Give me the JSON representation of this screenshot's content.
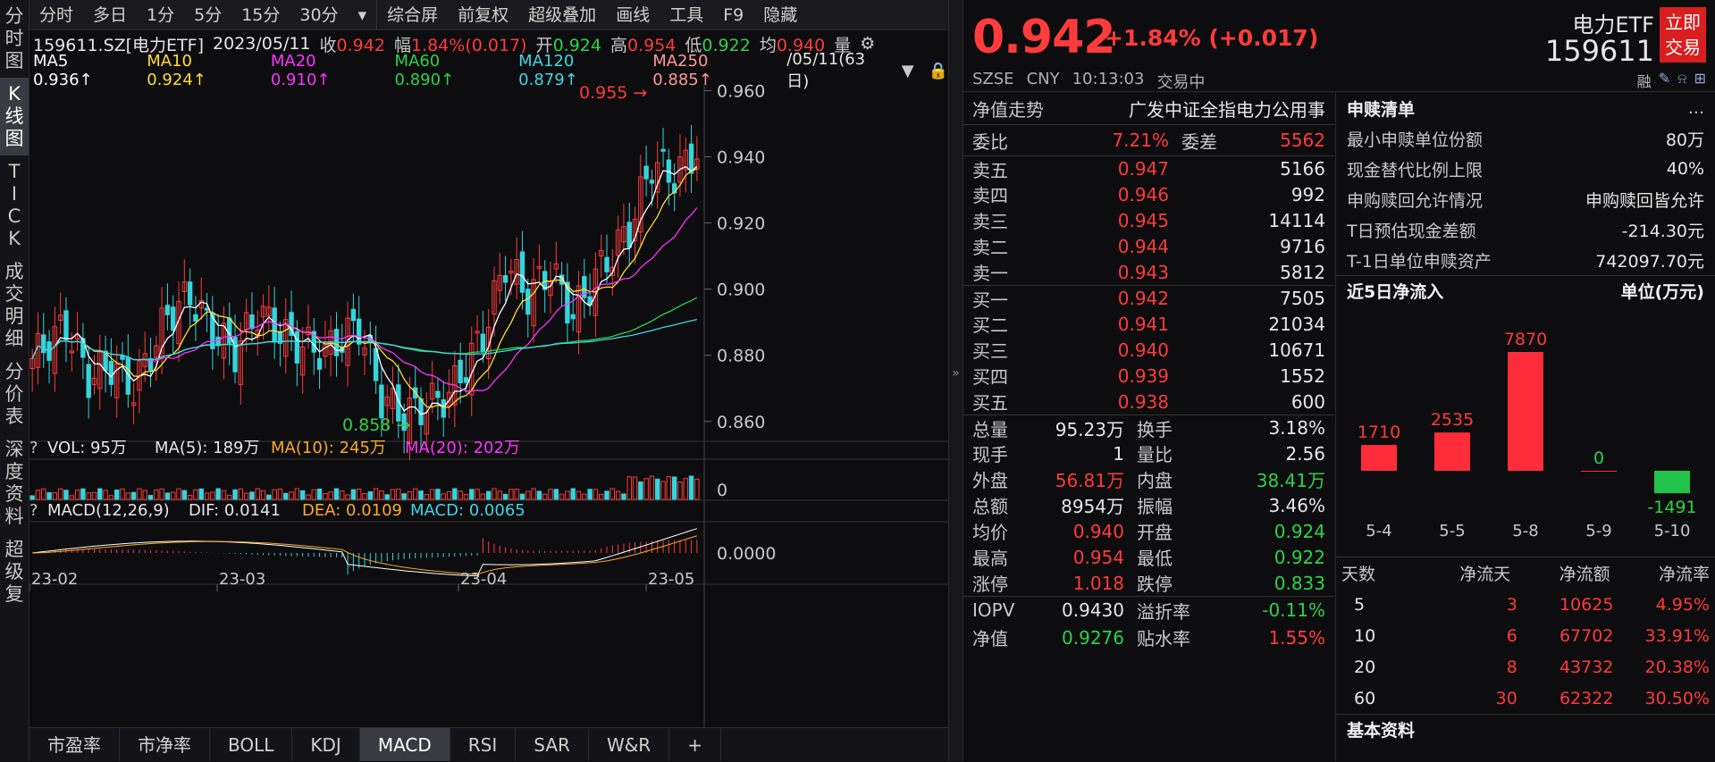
{
  "leftnav": [
    "分\n时\n图",
    "K\n线\n图",
    "T\nI\nC\nK",
    "成\n交\n明\n细",
    "分\n价\n表",
    "深\n度\n资\n料",
    "超\n级\n复"
  ],
  "toptools": [
    "分时",
    "多日",
    "1分",
    "5分",
    "15分",
    "30分",
    "▾",
    "综合屏",
    "前复权",
    "超级叠加",
    "画线",
    "工具",
    "F9",
    "隐藏"
  ],
  "info": {
    "code": "159611.SZ[电力ETF]",
    "date": "2023/05/11",
    "close_l": "收",
    "close": "0.942",
    "amp_l": "幅",
    "amp": "1.84%(0.017)",
    "open_l": "开",
    "open": "0.924",
    "high_l": "高",
    "high": "0.954",
    "low_l": "低",
    "low": "0.922",
    "avg_l": "均",
    "avg": "0.940",
    "vol_l": "量"
  },
  "ma": {
    "ma5": "MA5  0.936↑",
    "ma10": "MA10  0.924↑",
    "ma20": "MA20  0.910↑",
    "ma60": "MA60  0.890↑",
    "ma120": "MA120  0.879↑",
    "ma250": "MA250  0.885↑",
    "range": "/05/11(63日)"
  },
  "chart_data": {
    "type": "candlestick",
    "ylabels": [
      "0.960",
      "0.940",
      "0.920",
      "0.900",
      "0.880",
      "0.860"
    ],
    "ylim": [
      0.854,
      0.962
    ],
    "xlabels": [
      "23-02",
      "23-03",
      "23-04",
      "23-05"
    ],
    "max_label": "0.955",
    "min_label": "0.858",
    "vol_label": "VOL: 95万",
    "vol_ma5": "MA(5): 189万",
    "vol_ma10": "MA(10): 245万",
    "vol_ma20": "MA(20): 202万",
    "vol_axis": "0",
    "macd_label": "MACD(12,26,9)",
    "dif": "DIF: 0.0141",
    "dea": "DEA: 0.0109",
    "macd": "MACD: 0.0065",
    "macd_axis": "0.0000"
  },
  "bottomtabs": [
    "市盈率",
    "市净率",
    "BOLL",
    "KDJ",
    "MACD",
    "RSI",
    "SAR",
    "W&R",
    "+"
  ],
  "header": {
    "price": "0.942",
    "change": "+1.84% (+0.017)",
    "market": "SZSE",
    "currency": "CNY",
    "time": "10:13:03",
    "status": "交易中",
    "name": "电力ETF",
    "code": "159611",
    "trade_btn": "立即交易",
    "rong": "融"
  },
  "ob": {
    "jzzs_l": "净值走势",
    "index": "广发中证全指电力公用事",
    "wb_l": "委比",
    "wb": "7.21%",
    "wc_l": "委差",
    "wc": "5562",
    "asks": [
      [
        "卖五",
        "0.947",
        "5166"
      ],
      [
        "卖四",
        "0.946",
        "992"
      ],
      [
        "卖三",
        "0.945",
        "14114"
      ],
      [
        "卖二",
        "0.944",
        "9716"
      ],
      [
        "卖一",
        "0.943",
        "5812"
      ]
    ],
    "bids": [
      [
        "买一",
        "0.942",
        "7505"
      ],
      [
        "买二",
        "0.941",
        "21034"
      ],
      [
        "买三",
        "0.940",
        "10671"
      ],
      [
        "买四",
        "0.939",
        "1552"
      ],
      [
        "买五",
        "0.938",
        "600"
      ]
    ],
    "stats": [
      [
        "总量",
        "95.23万",
        "换手",
        "3.18%"
      ],
      [
        "现手",
        "1",
        "量比",
        "2.56"
      ],
      [
        "外盘",
        "56.81万",
        "内盘",
        "38.41万"
      ],
      [
        "总额",
        "8954万",
        "振幅",
        "3.46%"
      ],
      [
        "均价",
        "0.940",
        "开盘",
        "0.924"
      ],
      [
        "最高",
        "0.954",
        "最低",
        "0.922"
      ],
      [
        "涨停",
        "1.018",
        "跌停",
        "0.833"
      ]
    ],
    "iopv": [
      [
        "IOPV",
        "0.9430",
        "溢折率",
        "-0.11%"
      ],
      [
        "净值",
        "0.9276",
        "贴水率",
        "1.55%"
      ]
    ]
  },
  "redeem": {
    "title": "申赎清单",
    "more": "...",
    "rows": [
      [
        "最小申赎单位份额",
        "80万"
      ],
      [
        "现金替代比例上限",
        "40%"
      ],
      [
        "申购赎回允许情况",
        "申购赎回皆允许"
      ],
      [
        "T日预估现金差额",
        "-214.30元"
      ],
      [
        "T-1日单位申赎资产",
        "742097.70元"
      ]
    ]
  },
  "flow": {
    "title": "近5日净流入",
    "unit": "单位(万元)",
    "days": [
      "5-4",
      "5-5",
      "5-8",
      "5-9",
      "5-10"
    ],
    "values": [
      1710,
      2535,
      7870,
      0,
      -1491
    ],
    "labels": [
      "1710",
      "2535",
      "7870",
      "0",
      "-1491"
    ]
  },
  "flowtbl": {
    "headers": [
      "天数",
      "净流天",
      "净流额",
      "净流率"
    ],
    "rows": [
      [
        "5",
        "3",
        "10625",
        "4.95%"
      ],
      [
        "10",
        "6",
        "67702",
        "33.91%"
      ],
      [
        "20",
        "8",
        "43732",
        "20.38%"
      ],
      [
        "60",
        "30",
        "62322",
        "30.50%"
      ]
    ]
  },
  "basic": "基本资料"
}
